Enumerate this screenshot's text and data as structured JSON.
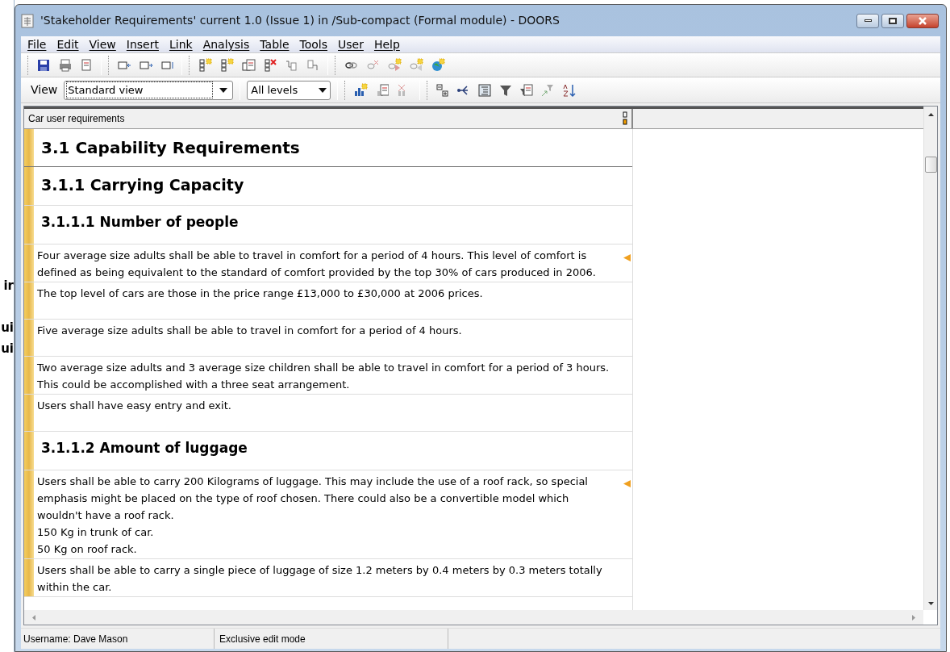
{
  "background_window": {
    "fragments": [
      "ir",
      "ui",
      "ui"
    ]
  },
  "window": {
    "title": "'Stakeholder Requirements' current 1.0 (Issue 1) in /Sub-compact (Formal module) - DOORS"
  },
  "menu": [
    "File",
    "Edit",
    "View",
    "Insert",
    "Link",
    "Analysis",
    "Table",
    "Tools",
    "User",
    "Help"
  ],
  "view_bar": {
    "label": "View",
    "view": "Standard view",
    "levels": "All levels"
  },
  "columns": [
    "Car user requirements"
  ],
  "rows": [
    {
      "kind": "title",
      "text": "3.1 Capability Requirements",
      "has_link": false
    },
    {
      "kind": "section",
      "text": "3.1.1 Carrying Capacity",
      "has_link": false
    },
    {
      "kind": "subsection",
      "text": "3.1.1.1 Number of people",
      "has_link": false
    },
    {
      "kind": "text",
      "text": "Four average size adults shall be able to travel in comfort for a period of 4 hours. This level of comfort is defined as being equivalent to the standard of comfort provided by the top 30% of cars produced in 2006.",
      "has_link": true
    },
    {
      "kind": "text",
      "text": "The top level of cars are those in the price range £13,000  to £30,000 at 2006 prices.",
      "has_link": false
    },
    {
      "kind": "text",
      "text": "Five average size adults shall be able to travel in comfort for a period of 4 hours.",
      "has_link": false
    },
    {
      "kind": "text",
      "text": "Two average size adults and 3 average size children shall be able to travel in comfort for a period of 3 hours. This could be accomplished with a three seat arrangement.",
      "has_link": false
    },
    {
      "kind": "text",
      "text": "Users shall have easy entry and exit.",
      "has_link": false
    },
    {
      "kind": "subsection",
      "text": "3.1.1.2 Amount of luggage",
      "has_link": false
    },
    {
      "kind": "text",
      "text": "Users shall be able to carry 200 Kilograms of luggage. This may include the use of a roof rack, so special emphasis might be placed on the type of roof chosen. There could also be a convertible model which wouldn't have a roof rack.\n150 Kg in trunk of car.\n50 Kg on roof rack.",
      "has_link": true
    },
    {
      "kind": "text",
      "text": "Users shall be able to carry a single piece of luggage of size 1.2 meters by 0.4 meters by 0.3 meters totally within the car.",
      "has_link": false
    }
  ],
  "status_bar": [
    "Username: Dave Mason",
    "Exclusive edit mode"
  ]
}
